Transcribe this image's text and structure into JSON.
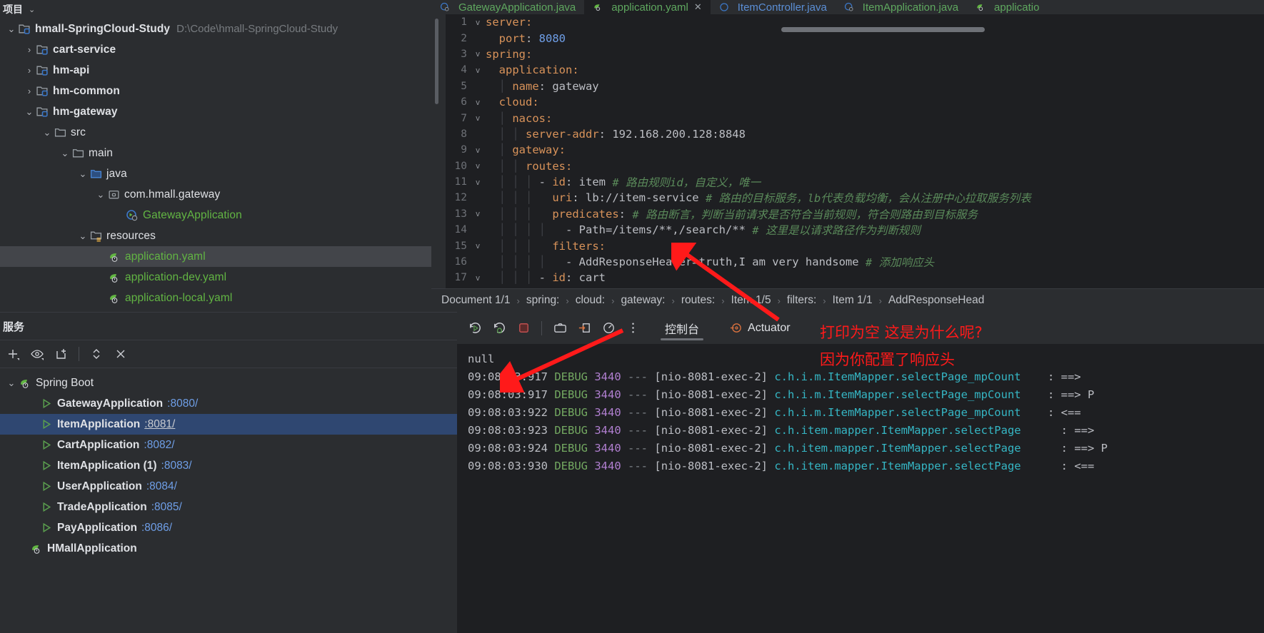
{
  "project": {
    "header_label": "项目",
    "root": {
      "name": "hmall-SpringCloud-Study",
      "path": "D:\\Code\\hmall-SpringCloud-Study"
    },
    "nodes": [
      {
        "label": "hmall-SpringCloud-Study",
        "path": "D:\\Code\\hmall-SpringCloud-Study",
        "indent": 0,
        "arrow": "v",
        "icon": "module-icon",
        "style": "bold"
      },
      {
        "label": "cart-service",
        "path": "",
        "indent": 1,
        "arrow": ">",
        "icon": "module-icon",
        "style": "bold"
      },
      {
        "label": "hm-api",
        "path": "",
        "indent": 1,
        "arrow": ">",
        "icon": "module-icon",
        "style": "bold"
      },
      {
        "label": "hm-common",
        "path": "",
        "indent": 1,
        "arrow": ">",
        "icon": "module-icon",
        "style": "bold"
      },
      {
        "label": "hm-gateway",
        "path": "",
        "indent": 1,
        "arrow": "v",
        "icon": "module-icon",
        "style": "bold"
      },
      {
        "label": "src",
        "path": "",
        "indent": 2,
        "arrow": "v",
        "icon": "folder-icon",
        "style": "plain"
      },
      {
        "label": "main",
        "path": "",
        "indent": 3,
        "arrow": "v",
        "icon": "folder-icon",
        "style": "plain"
      },
      {
        "label": "java",
        "path": "",
        "indent": 4,
        "arrow": "v",
        "icon": "source-folder-icon",
        "style": "plain"
      },
      {
        "label": "com.hmall.gateway",
        "path": "",
        "indent": 5,
        "arrow": "v",
        "icon": "package-icon",
        "style": "plain"
      },
      {
        "label": "GatewayApplication",
        "path": "",
        "indent": 6,
        "arrow": "none",
        "icon": "spring-class-icon",
        "style": "green"
      },
      {
        "label": "resources",
        "path": "",
        "indent": 4,
        "arrow": "v",
        "icon": "resources-folder-icon",
        "style": "plain"
      },
      {
        "label": "application.yaml",
        "path": "",
        "indent": 5,
        "arrow": "none",
        "icon": "spring-yaml-icon",
        "style": "green",
        "selected": true
      },
      {
        "label": "application-dev.yaml",
        "path": "",
        "indent": 5,
        "arrow": "none",
        "icon": "spring-yaml-icon",
        "style": "green"
      },
      {
        "label": "application-local.yaml",
        "path": "",
        "indent": 5,
        "arrow": "none",
        "icon": "spring-yaml-icon",
        "style": "green"
      }
    ]
  },
  "services": {
    "title": "服务",
    "toolbar_icons": [
      "add-icon",
      "eye-icon",
      "new-tab-icon",
      "expand-collapse-icon",
      "close-all-icon"
    ],
    "group": {
      "label": "Spring Boot",
      "arrow": "v",
      "icon": "spring-icon"
    },
    "items": [
      {
        "name": "GatewayApplication",
        "port": ":8080/",
        "selected": false
      },
      {
        "name": "ItemApplication",
        "port": ":8081/",
        "selected": true
      },
      {
        "name": "CartApplication",
        "port": ":8082/",
        "selected": false
      },
      {
        "name": "ItemApplication (1)",
        "port": ":8083/",
        "selected": false
      },
      {
        "name": "UserApplication",
        "port": ":8084/",
        "selected": false
      },
      {
        "name": "TradeApplication",
        "port": ":8085/",
        "selected": false
      },
      {
        "name": "PayApplication",
        "port": ":8086/",
        "selected": false
      },
      {
        "name": "HMallApplication",
        "port": "",
        "selected": false,
        "icon": "spring-icon",
        "no_run_icon": true
      }
    ]
  },
  "editor": {
    "tabs": [
      {
        "label": "GatewayApplication.java",
        "icon": "java-spring-icon",
        "color": "green",
        "active": false,
        "closable": false
      },
      {
        "label": "application.yaml",
        "icon": "spring-yaml-icon",
        "color": "green",
        "active": true,
        "closable": true,
        "close": "✕"
      },
      {
        "label": "ItemController.java",
        "icon": "java-icon",
        "color": "blue",
        "active": false,
        "closable": false
      },
      {
        "label": "ItemApplication.java",
        "icon": "java-spring-icon",
        "color": "green",
        "active": false,
        "closable": false
      },
      {
        "label": "applicatio",
        "icon": "spring-yaml-icon",
        "color": "green",
        "active": false,
        "closable": false
      }
    ],
    "lines": [
      {
        "n": "1",
        "fold": "v",
        "indent": 0,
        "text": "server:",
        "kind": "key"
      },
      {
        "n": "2",
        "fold": "",
        "indent": 1,
        "text": "port: 8080",
        "kind": "key-num"
      },
      {
        "n": "3",
        "fold": "v",
        "indent": 0,
        "text": "spring:",
        "kind": "key"
      },
      {
        "n": "4",
        "fold": "v",
        "indent": 1,
        "text": "application:",
        "kind": "key"
      },
      {
        "n": "5",
        "fold": "",
        "indent": 2,
        "text": "name: gateway",
        "kind": "key-val"
      },
      {
        "n": "6",
        "fold": "v",
        "indent": 1,
        "text": "cloud:",
        "kind": "key"
      },
      {
        "n": "7",
        "fold": "v",
        "indent": 2,
        "text": "nacos:",
        "kind": "key"
      },
      {
        "n": "8",
        "fold": "",
        "indent": 3,
        "text": "server-addr: 192.168.200.128:8848",
        "kind": "key-val"
      },
      {
        "n": "9",
        "fold": "v",
        "indent": 2,
        "text": "gateway:",
        "kind": "key"
      },
      {
        "n": "10",
        "fold": "v",
        "indent": 3,
        "text": "routes:",
        "kind": "key"
      },
      {
        "n": "11",
        "fold": "v",
        "indent": 4,
        "text": "- id: item",
        "comment": "# 路由规则id，自定义，唯一",
        "kind": "item"
      },
      {
        "n": "12",
        "fold": "",
        "indent": 5,
        "text": "uri: lb://item-service",
        "comment": "# 路由的目标服务，lb代表负载均衡，会从注册中心拉取服务列表",
        "kind": "key-val"
      },
      {
        "n": "13",
        "fold": "v",
        "indent": 5,
        "text": "predicates:",
        "comment": "# 路由断言，判断当前请求是否符合当前规则，符合则路由到目标服务",
        "kind": "key"
      },
      {
        "n": "14",
        "fold": "",
        "indent": 6,
        "text": "- Path=/items/**,/search/**",
        "comment": "# 这里是以请求路径作为判断规则",
        "kind": "item-plain"
      },
      {
        "n": "15",
        "fold": "v",
        "indent": 5,
        "text": "filters:",
        "kind": "key"
      },
      {
        "n": "16",
        "fold": "",
        "indent": 6,
        "text": "- AddResponseHeader=truth,I am very handsome",
        "comment": "# 添加响应头",
        "kind": "item-plain"
      },
      {
        "n": "17",
        "fold": "v",
        "indent": 4,
        "text": "- id: cart",
        "kind": "item"
      }
    ],
    "breadcrumbs": [
      "Document 1/1",
      "spring:",
      "cloud:",
      "gateway:",
      "routes:",
      "Item 1/5",
      "filters:",
      "Item 1/1",
      "AddResponseHead"
    ]
  },
  "console": {
    "toolbar_icons": [
      "rerun-icon",
      "rerun-debug-icon",
      "stop-icon",
      "camera-icon",
      "export-icon",
      "gauge-icon",
      "more-icon"
    ],
    "tabs": [
      {
        "label": "控制台",
        "active": true,
        "icon": ""
      },
      {
        "label": "Actuator",
        "active": false,
        "icon": "actuator-icon"
      }
    ],
    "log": [
      {
        "raw": "null",
        "kind": "plain"
      },
      {
        "time": "09:08:03:917",
        "level": "DEBUG",
        "pid": "3440",
        "dash": "---",
        "thread": "[nio-8081-exec-2]",
        "logger": "c.h.i.m.ItemMapper.selectPage_mpCount",
        "sep": ":",
        "arrow": "==>"
      },
      {
        "time": "09:08:03:917",
        "level": "DEBUG",
        "pid": "3440",
        "dash": "---",
        "thread": "[nio-8081-exec-2]",
        "logger": "c.h.i.m.ItemMapper.selectPage_mpCount",
        "sep": ":",
        "arrow": "==> P"
      },
      {
        "time": "09:08:03:922",
        "level": "DEBUG",
        "pid": "3440",
        "dash": "---",
        "thread": "[nio-8081-exec-2]",
        "logger": "c.h.i.m.ItemMapper.selectPage_mpCount",
        "sep": ":",
        "arrow": "<=="
      },
      {
        "time": "09:08:03:923",
        "level": "DEBUG",
        "pid": "3440",
        "dash": "---",
        "thread": "[nio-8081-exec-2]",
        "logger": "c.h.item.mapper.ItemMapper.selectPage",
        "sep": ":",
        "arrow": "==>"
      },
      {
        "time": "09:08:03:924",
        "level": "DEBUG",
        "pid": "3440",
        "dash": "---",
        "thread": "[nio-8081-exec-2]",
        "logger": "c.h.item.mapper.ItemMapper.selectPage",
        "sep": ":",
        "arrow": "==> P"
      },
      {
        "time": "09:08:03:930",
        "level": "DEBUG",
        "pid": "3440",
        "dash": "---",
        "thread": "[nio-8081-exec-2]",
        "logger": "c.h.item.mapper.ItemMapper.selectPage",
        "sep": ":",
        "arrow": "<=="
      }
    ]
  },
  "annotations": {
    "line1": "打印为空 这是为什么呢?",
    "line2": "因为你配置了响应头",
    "color": "#ff1a1a"
  }
}
